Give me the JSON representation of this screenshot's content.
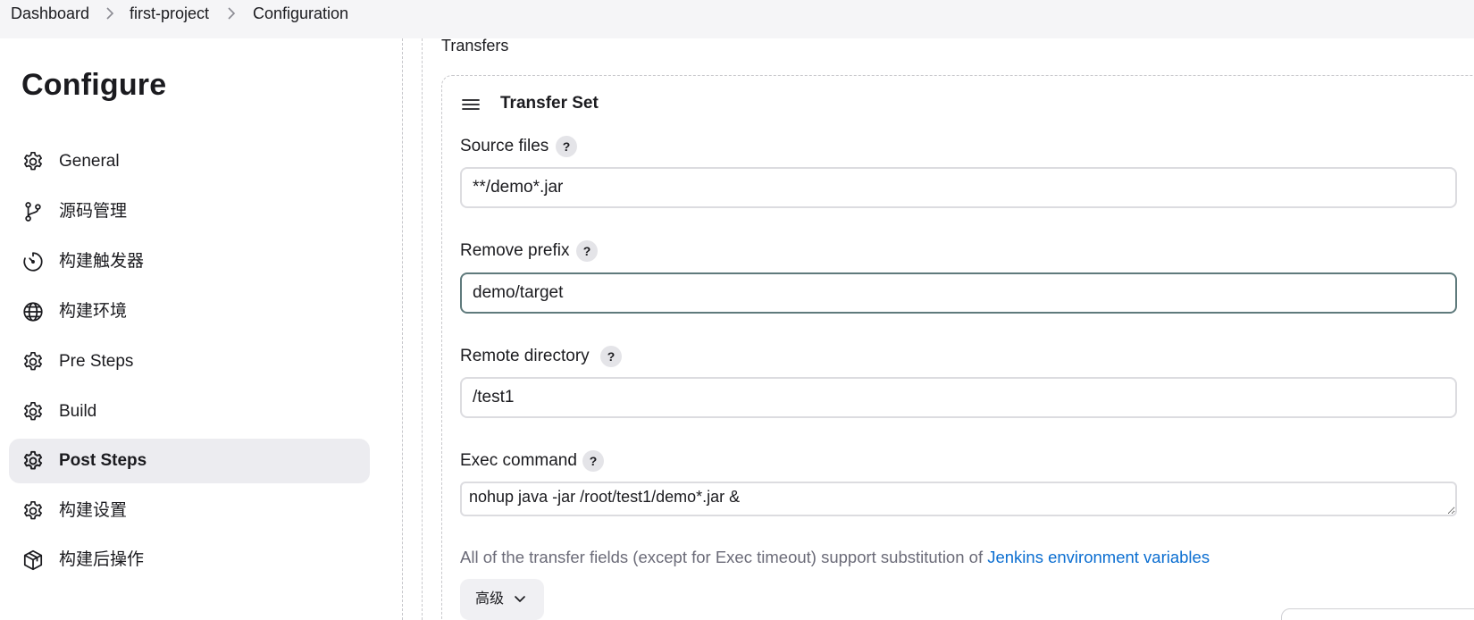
{
  "breadcrumb": {
    "items": [
      "Dashboard",
      "first-project",
      "Configuration"
    ]
  },
  "sidebar": {
    "title": "Configure",
    "items": [
      {
        "label": "General",
        "icon": "gear-icon"
      },
      {
        "label": "源码管理",
        "icon": "branch-icon"
      },
      {
        "label": "构建触发器",
        "icon": "timer-icon"
      },
      {
        "label": "构建环境",
        "icon": "globe-icon"
      },
      {
        "label": "Pre Steps",
        "icon": "gear-icon"
      },
      {
        "label": "Build",
        "icon": "gear-icon"
      },
      {
        "label": "Post Steps",
        "icon": "gear-icon",
        "active": true
      },
      {
        "label": "构建设置",
        "icon": "gear-icon"
      },
      {
        "label": "构建后操作",
        "icon": "package-icon"
      }
    ]
  },
  "main": {
    "transfers_label": "Transfers",
    "transfer_set": {
      "title": "Transfer Set",
      "help_symbol": "?",
      "source_files": {
        "label": "Source files",
        "value": "**/demo*.jar"
      },
      "remove_prefix": {
        "label": "Remove prefix",
        "value": "demo/target"
      },
      "remote_directory": {
        "label": "Remote directory",
        "value": "/test1"
      },
      "exec_command": {
        "label": "Exec command",
        "value": "nohup java -jar /root/test1/demo*.jar &"
      },
      "note_text": "All of the transfer fields (except for Exec timeout) support substitution of ",
      "note_link": "Jenkins environment variables",
      "advanced_label": "高级"
    }
  },
  "colors": {
    "active_nav_bg": "#ececf0",
    "link": "#0b6ed1",
    "focused_border": "#5f7a7c"
  }
}
